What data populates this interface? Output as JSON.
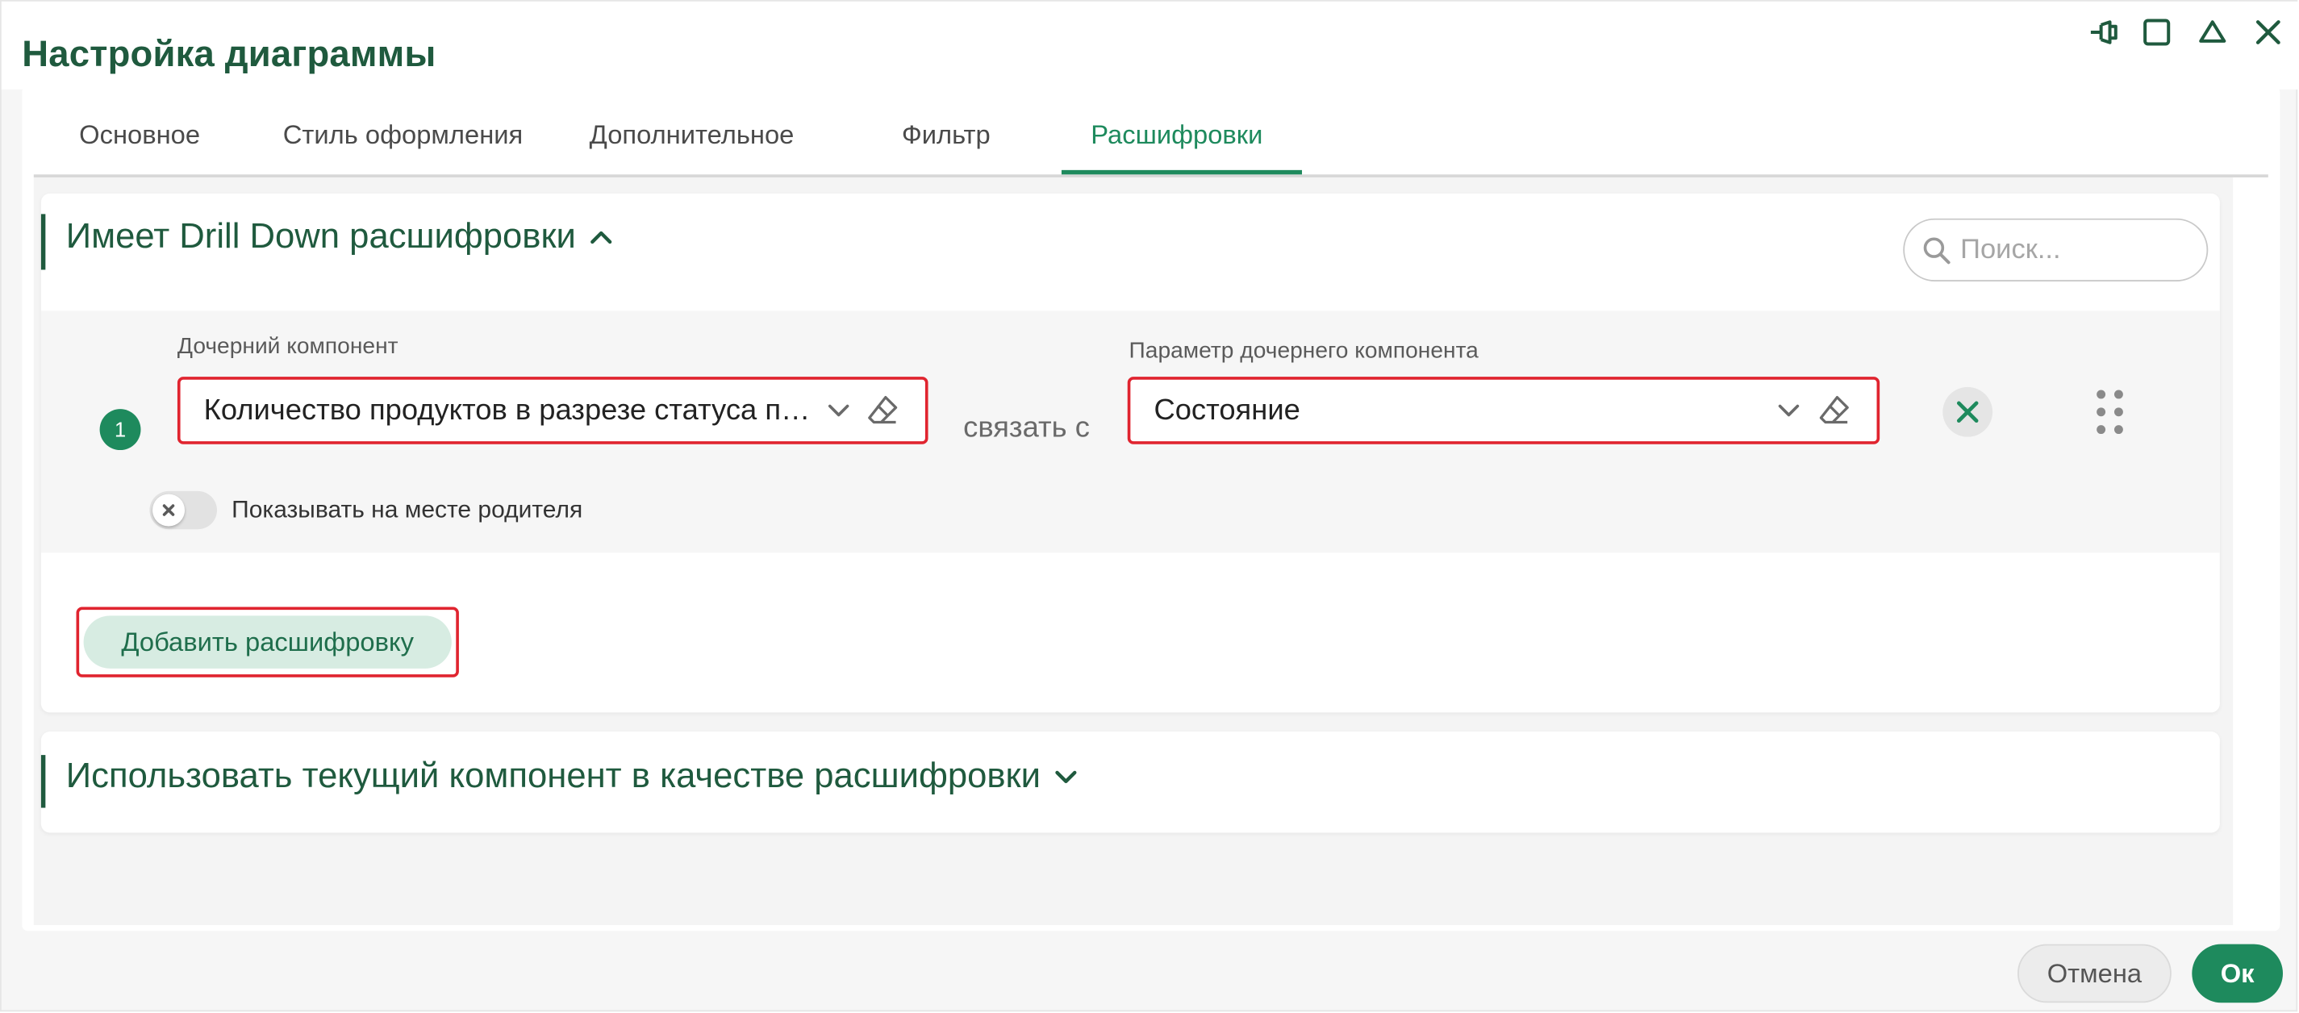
{
  "dialog": {
    "title": "Настройка диаграммы"
  },
  "tabs": [
    {
      "label": "Основное"
    },
    {
      "label": "Стиль оформления"
    },
    {
      "label": "Дополнительное"
    },
    {
      "label": "Фильтр"
    },
    {
      "label": "Расшифровки",
      "active": true
    }
  ],
  "drill_section": {
    "title": "Имеет Drill Down расшифровки",
    "expanded": true,
    "search": {
      "placeholder": "Поиск...",
      "value": ""
    },
    "rows": [
      {
        "index": "1",
        "child_component_label": "Дочерний компонент",
        "child_component_value": "Количество продуктов в разрезе статуса по дням",
        "link_text": "связать с",
        "child_param_label": "Параметр дочернего компонента",
        "child_param_value": "Состояние",
        "show_in_parent_place_label": "Показывать на месте родителя",
        "show_in_parent_place": false
      }
    ],
    "add_button_label": "Добавить расшифровку"
  },
  "use_current_section": {
    "title": "Использовать текущий компонент в качестве расшифровки",
    "expanded": false
  },
  "footer": {
    "cancel_label": "Отмена",
    "ok_label": "Ок"
  },
  "colors": {
    "primary_green": "#1e8a5d",
    "title_green": "#1f5a3e",
    "highlight_red": "#e0242f"
  }
}
